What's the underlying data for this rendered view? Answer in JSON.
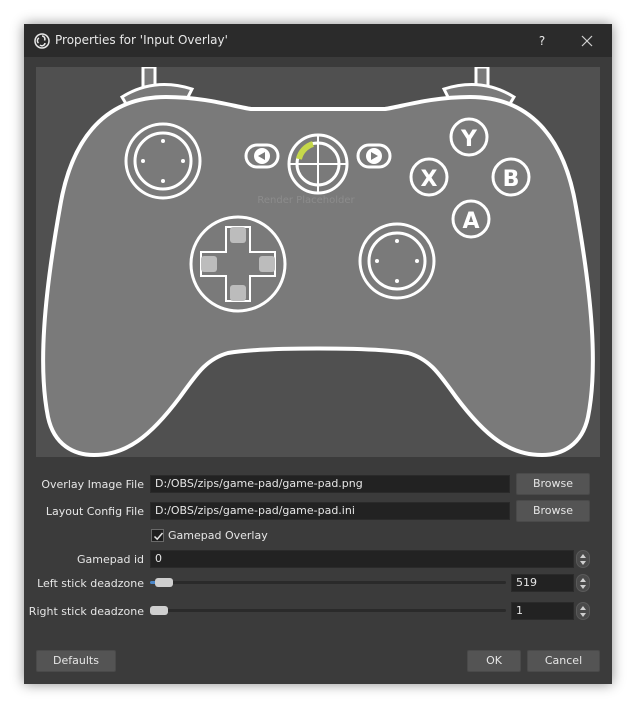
{
  "window": {
    "title": "Properties for 'Input Overlay'",
    "help_glyph": "?"
  },
  "preview": {
    "watermark_text": "Render Placeholder"
  },
  "form": {
    "overlay_image": {
      "label": "Overlay Image File",
      "value": "D:/OBS/zips/game-pad/game-pad.png",
      "browse_label": "Browse"
    },
    "layout_config": {
      "label": "Layout Config File",
      "value": "D:/OBS/zips/game-pad/game-pad.ini",
      "browse_label": "Browse"
    },
    "gamepad_overlay": {
      "label": "Gamepad Overlay",
      "checked": true
    },
    "gamepad_id": {
      "label": "Gamepad id",
      "value": "0"
    },
    "left_deadzone": {
      "label": "Left stick deadzone",
      "value": "519",
      "level": 0.016
    },
    "right_deadzone": {
      "label": "Right stick deadzone",
      "value": "1",
      "level": 0.0
    }
  },
  "footer": {
    "defaults_label": "Defaults",
    "ok_label": "OK",
    "cancel_label": "Cancel"
  },
  "gamepad": {
    "button_y": "Y",
    "button_x": "X",
    "button_b": "B",
    "button_a": "A",
    "outline_color": "#ffffff",
    "body_color": "#7a7a7a",
    "accent_color": "#c6d84a"
  },
  "colors": {
    "window_bg": "#3b3b3b",
    "titlebar_bg": "#2b2b2b",
    "preview_bg": "#505050",
    "slider_fill": "#4a86c8"
  }
}
